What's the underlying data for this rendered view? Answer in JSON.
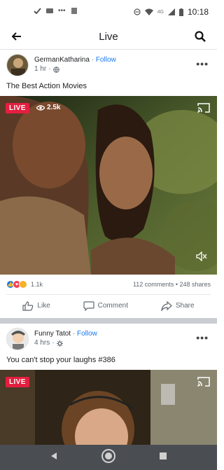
{
  "status_bar": {
    "time": "10:18",
    "network": "4G"
  },
  "topbar": {
    "title": "Live"
  },
  "posts": [
    {
      "author": "GermanKatharina",
      "follow_label": "Follow",
      "time": "1 hr",
      "caption": "The Best Action Movies",
      "live_label": "LIVE",
      "viewers": "2.5k",
      "reaction_count": "1.1k",
      "comments_shares": "112 comments • 248 shares",
      "like_label": "Like",
      "comment_label": "Comment",
      "share_label": "Share"
    },
    {
      "author": "Funny Tatot",
      "follow_label": "Follow",
      "time": "4 hrs",
      "caption": "You can't stop your laughs #386",
      "live_label": "LIVE"
    }
  ],
  "colors": {
    "accent": "#1877f2",
    "live": "#e41e3f",
    "navbar": "#4a4d52"
  }
}
